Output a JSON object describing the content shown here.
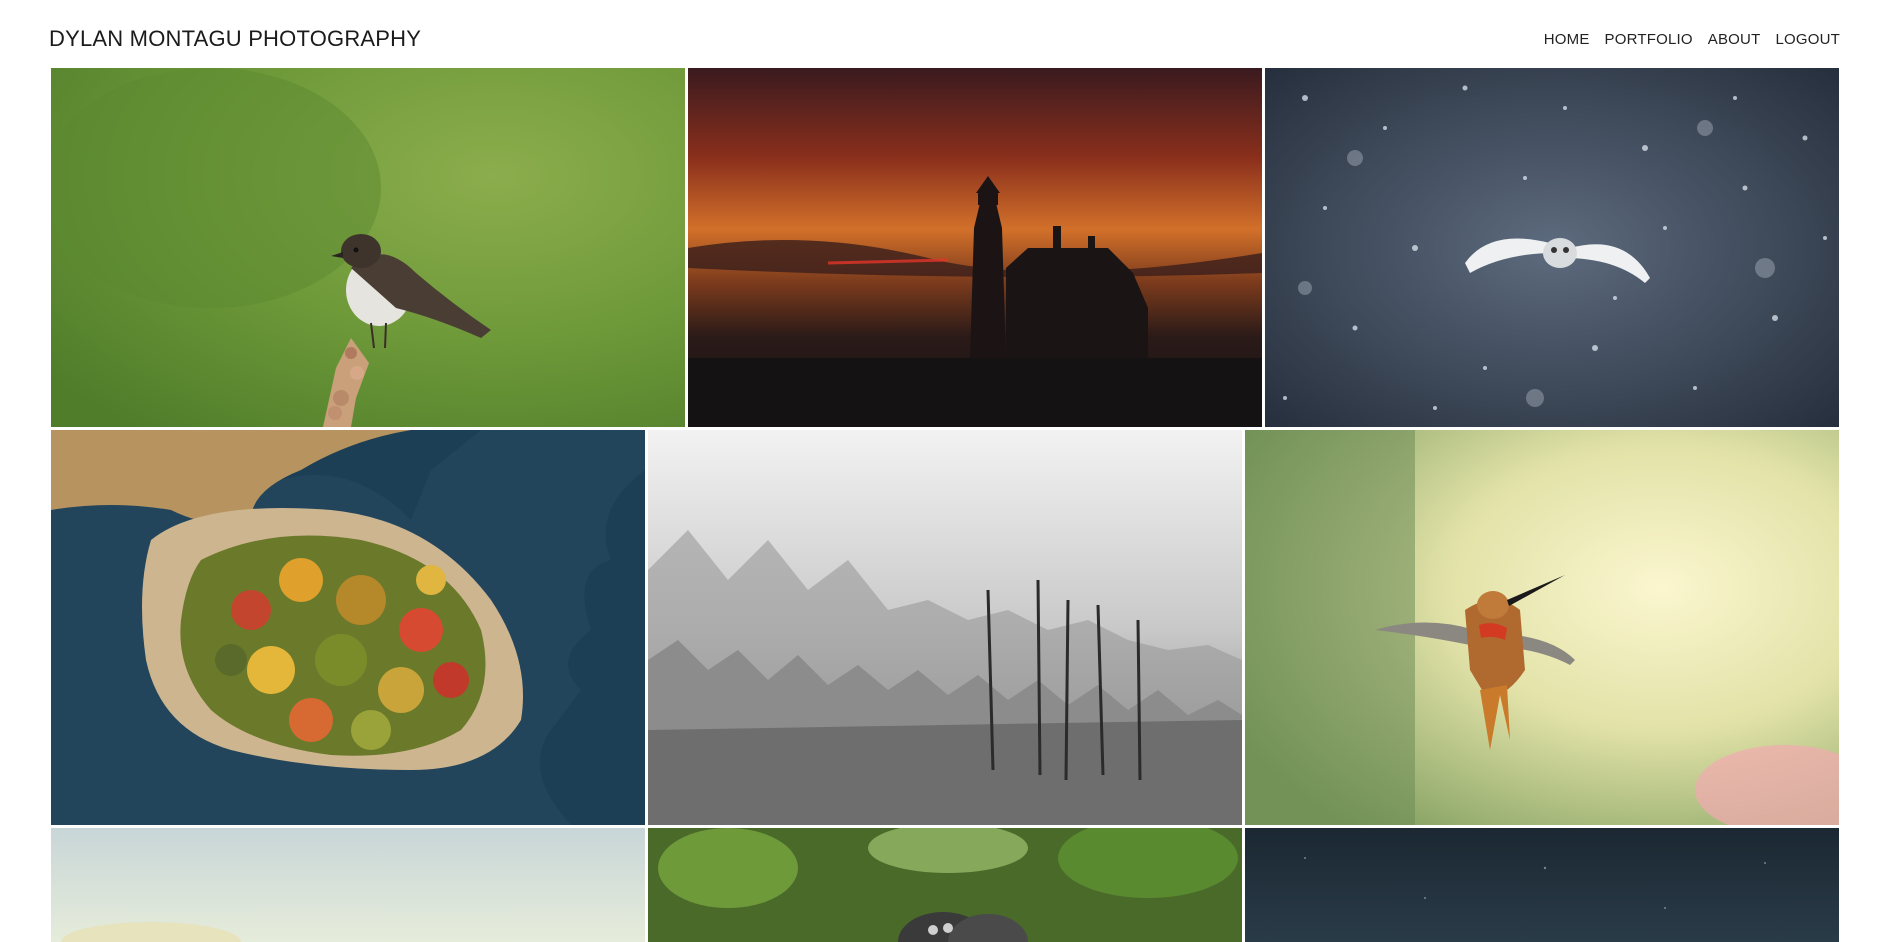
{
  "site": {
    "title": "DYLAN MONTAGU PHOTOGRAPHY"
  },
  "nav": {
    "items": [
      {
        "label": "HOME"
      },
      {
        "label": "PORTFOLIO"
      },
      {
        "label": "ABOUT"
      },
      {
        "label": "LOGOUT"
      }
    ]
  },
  "gallery": {
    "photos": [
      {
        "subject": "sparrow"
      },
      {
        "subject": "lighthouse"
      },
      {
        "subject": "owl"
      },
      {
        "subject": "island"
      },
      {
        "subject": "forest"
      },
      {
        "subject": "hummingbird"
      },
      {
        "subject": "sky"
      },
      {
        "subject": "monkeys"
      },
      {
        "subject": "night-sky"
      }
    ]
  },
  "colors": {
    "background": "#ffffff",
    "text": "#222222"
  }
}
